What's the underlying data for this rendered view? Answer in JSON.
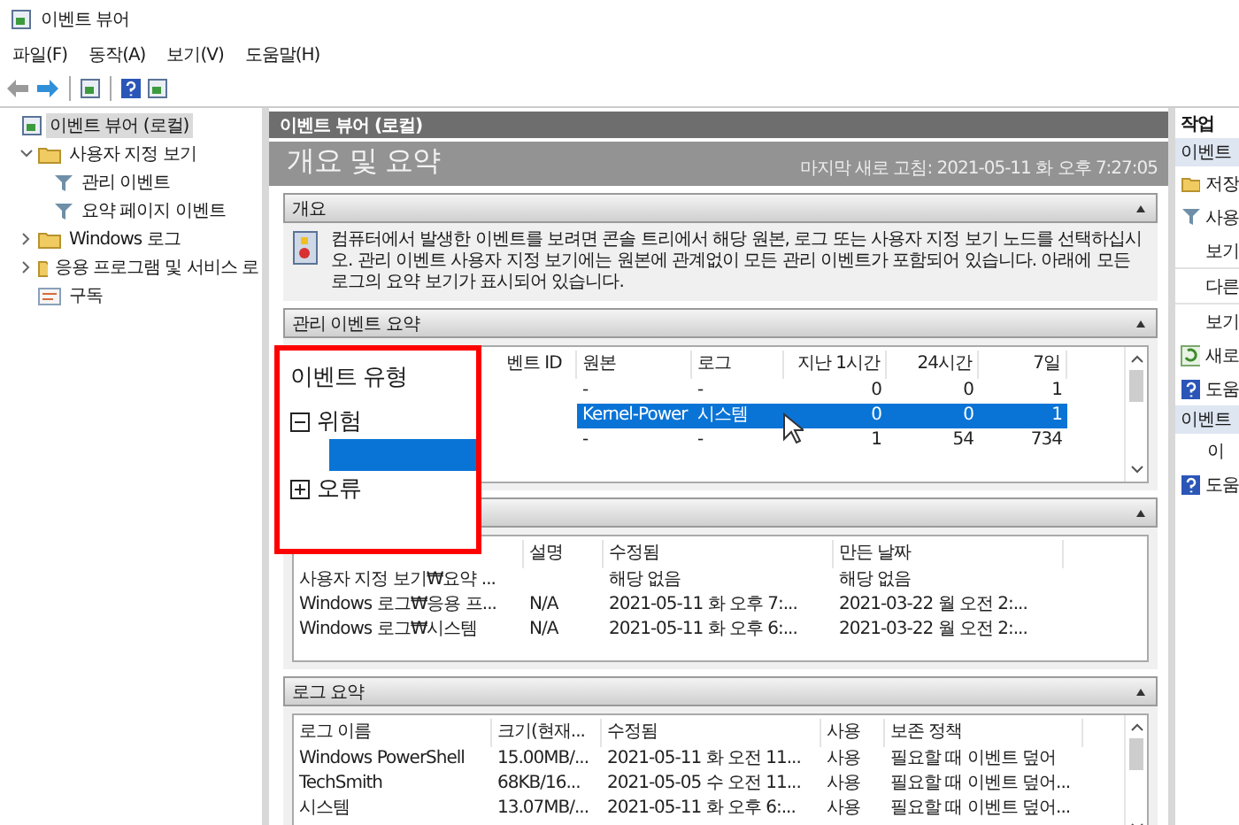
{
  "window": {
    "title": "이벤트 뷰어"
  },
  "menu": [
    "파일(F)",
    "동작(A)",
    "보기(V)",
    "도움말(H)"
  ],
  "toolbar": [
    {
      "kind": "back",
      "disabled": true
    },
    {
      "kind": "forward",
      "disabled": false
    },
    {
      "kind": "console",
      "disabled": false
    },
    {
      "kind": "help",
      "disabled": false
    },
    {
      "kind": "console",
      "disabled": false
    }
  ],
  "tree": [
    {
      "label": "이벤트 뷰어 (로컬)",
      "kind": "viewer",
      "selected": true,
      "children": [
        {
          "label": "사용자 지정 보기",
          "kind": "folder",
          "selected": false,
          "expanded": true,
          "children": [
            {
              "label": "관리 이벤트",
              "kind": "filter",
              "selected": false
            },
            {
              "label": "요약 페이지 이벤트",
              "kind": "filter",
              "selected": false
            }
          ]
        },
        {
          "label": "Windows 로그",
          "kind": "folder",
          "selected": false,
          "expanded": false
        },
        {
          "label": "응용 프로그램 및 서비스 로",
          "kind": "folder",
          "selected": false,
          "expanded": false
        },
        {
          "label": "구독",
          "kind": "subscription",
          "selected": false
        }
      ]
    }
  ],
  "center": {
    "header": "이벤트 뷰어 (로컬)",
    "title": "개요 및 요약",
    "refreshed": "마지막 새로 고침: 2021-05-11 화 오후 7:27:05",
    "sections": [
      {
        "kind": "text",
        "title": "개요",
        "body": "컴퓨터에서 발생한 이벤트를 보려면 콘솔 트리에서 해당 원본, 로그 또는 사용자 지정 보기 노드를 선택하십시오. 관리 이벤트 사용자 지정 보기에는 원본에 관계없이 모든 관리 이벤트가 포함되어 있습니다. 아래에 모든 로그의 요약 보기가 표시되어 있습니다."
      },
      {
        "kind": "table",
        "title": "관리 이벤트 요약",
        "columns": [
          "벤트 ID",
          "원본",
          "로그",
          "지난 1시간",
          "24시간",
          "7일"
        ],
        "rows": [
          {
            "cells": [
              "",
              "-",
              "-",
              "0",
              "0",
              "1"
            ],
            "selected": false
          },
          {
            "cells": [
              "",
              "Kernel-Power",
              "시스템",
              "0",
              "0",
              "1"
            ],
            "selected": true
          },
          {
            "cells": [
              "",
              "-",
              "-",
              "1",
              "54",
              "734"
            ],
            "selected": false
          }
        ]
      },
      {
        "kind": "table",
        "columns": [
          "",
          "설명",
          "수정됨",
          "만든 날짜"
        ],
        "rows": [
          {
            "cells": [
              "사용자 지정 보기₩요약 ...",
              "",
              "해당 없음",
              "해당 없음"
            ],
            "selected": false
          },
          {
            "cells": [
              "Windows 로그₩응용 프...",
              "N/A",
              "2021-05-11 화 오후 7:...",
              "2021-03-22 월 오전 2:..."
            ],
            "selected": false
          },
          {
            "cells": [
              "Windows 로그₩시스템",
              "N/A",
              "2021-05-11 화 오후 6:...",
              "2021-03-22 월 오전 2:..."
            ],
            "selected": false
          }
        ]
      },
      {
        "kind": "table",
        "title": "로그 요약",
        "columns": [
          "로그 이름",
          "크기(현재...",
          "수정됨",
          "사용",
          "보존 정책"
        ],
        "rows": [
          {
            "cells": [
              "Windows PowerShell",
              "15.00MB/...",
              "2021-05-11 화 오전 11...",
              "사용",
              "필요할 때 이벤트 덮어"
            ],
            "selected": false
          },
          {
            "cells": [
              "TechSmith",
              "68KB/16...",
              "2021-05-05 수 오전 11...",
              "사용",
              "필요할 때 이벤트 덮어..."
            ],
            "selected": false
          },
          {
            "cells": [
              "시스템",
              "13.07MB/...",
              "2021-05-11 화 오후 6:...",
              "사용",
              "필요할 때 이벤트 덮어..."
            ],
            "selected": false
          }
        ]
      }
    ]
  },
  "popup": {
    "title": "이벤트 유형",
    "items": [
      {
        "label": "위험",
        "expanded": true,
        "children": [
          {
            "selected": true
          }
        ]
      },
      {
        "label": "오류",
        "expanded": false
      }
    ]
  },
  "actions": {
    "title": "작업",
    "groups": [
      {
        "title": "이벤트",
        "items": [
          {
            "label": "저장",
            "kind": "open"
          },
          {
            "label": "사용",
            "kind": "filter"
          },
          {
            "label": "보기",
            "kind": "plain"
          },
          {
            "label": "다른",
            "kind": "plain"
          },
          {
            "label": "보기",
            "kind": "plain"
          },
          {
            "label": "새로",
            "kind": "refresh"
          },
          {
            "label": "도움",
            "kind": "help"
          }
        ]
      },
      {
        "title": "이벤트",
        "items": [
          {
            "label": "이",
            "kind": "plain"
          },
          {
            "label": "도움",
            "kind": "help"
          }
        ]
      }
    ]
  }
}
